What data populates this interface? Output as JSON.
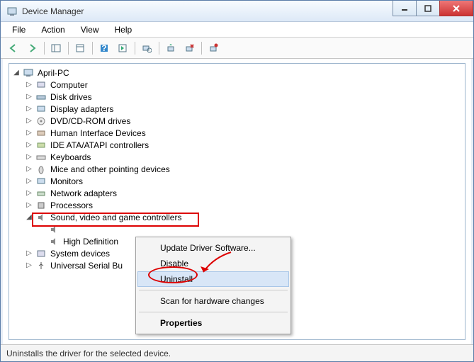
{
  "window": {
    "title": "Device Manager"
  },
  "menubar": {
    "file": "File",
    "action": "Action",
    "view": "View",
    "help": "Help"
  },
  "tree": {
    "root": "April-PC",
    "items": [
      "Computer",
      "Disk drives",
      "Display adapters",
      "DVD/CD-ROM drives",
      "Human Interface Devices",
      "IDE ATA/ATAPI controllers",
      "Keyboards",
      "Mice and other pointing devices",
      "Monitors",
      "Network adapters",
      "Processors",
      "Sound, video and game controllers",
      "System devices",
      "Universal Serial Bu"
    ],
    "sound_children": [
      "",
      "High Definition"
    ]
  },
  "context_menu": {
    "update": "Update Driver Software...",
    "disable": "Disable",
    "uninstall": "Uninstall",
    "scan": "Scan for hardware changes",
    "properties": "Properties"
  },
  "statusbar": {
    "text": "Uninstalls the driver for the selected device."
  }
}
